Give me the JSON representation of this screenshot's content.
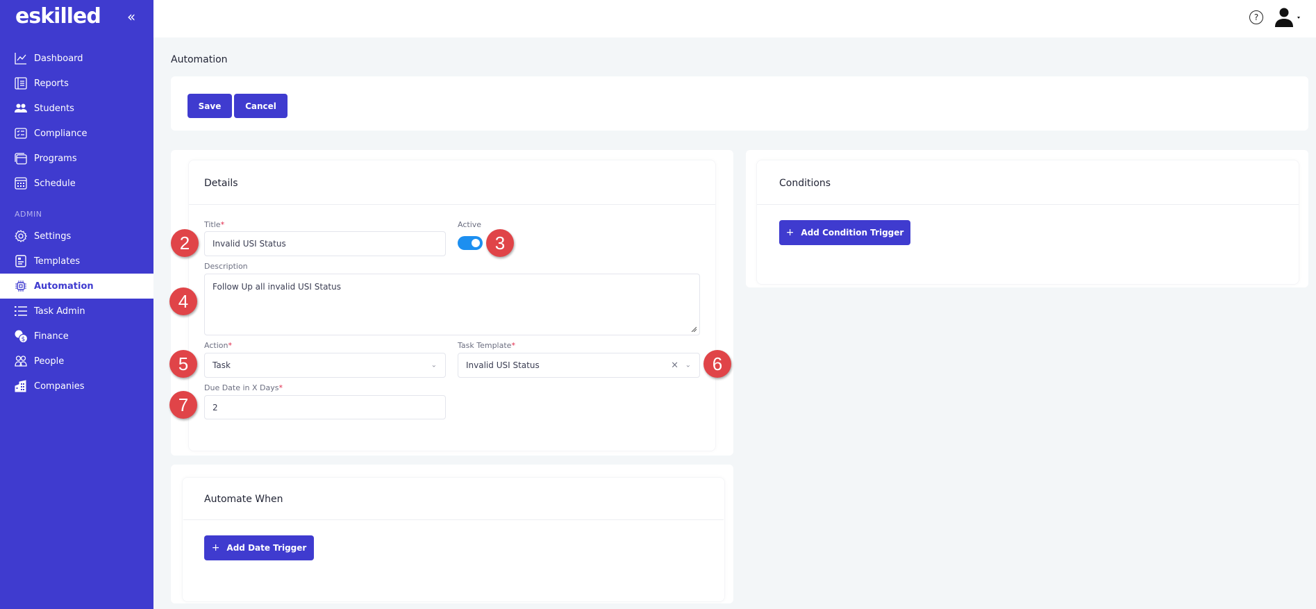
{
  "app": {
    "logo": "eskilled",
    "collapse_icon": "chevrons-left-icon"
  },
  "sidebar": {
    "items": [
      {
        "label": "Dashboard",
        "icon": "chart-line-icon"
      },
      {
        "label": "Reports",
        "icon": "report-icon"
      },
      {
        "label": "Students",
        "icon": "users-icon"
      },
      {
        "label": "Compliance",
        "icon": "checklist-icon"
      },
      {
        "label": "Programs",
        "icon": "window-stack-icon"
      },
      {
        "label": "Schedule",
        "icon": "calendar-icon"
      }
    ],
    "section_label": "ADMIN",
    "admin_items": [
      {
        "label": "Settings",
        "icon": "gear-icon"
      },
      {
        "label": "Templates",
        "icon": "template-icon"
      },
      {
        "label": "Automation",
        "icon": "chip-icon",
        "active": true
      },
      {
        "label": "Task Admin",
        "icon": "list-icon"
      },
      {
        "label": "Finance",
        "icon": "coins-icon"
      },
      {
        "label": "People",
        "icon": "people-icon"
      },
      {
        "label": "Companies",
        "icon": "building-icon"
      }
    ]
  },
  "topbar": {
    "help_icon": "help-circle-icon",
    "help_glyph": "?",
    "user_icon": "user-avatar-icon"
  },
  "page": {
    "title": "Automation",
    "toolbar": {
      "save_label": "Save",
      "cancel_label": "Cancel"
    }
  },
  "details": {
    "title": "Details",
    "title_label": "Title",
    "title_value": "Invalid USI Status",
    "active_label": "Active",
    "active_value": true,
    "description_label": "Description",
    "description_value": "Follow Up all invalid USI Status",
    "action_label": "Action",
    "action_value": "Task",
    "task_template_label": "Task Template",
    "task_template_value": "Invalid USI Status",
    "due_date_label": "Due Date in X Days",
    "due_date_value": "2",
    "required_mark": "*"
  },
  "automate_when": {
    "title": "Automate When",
    "add_button": "Add Date Trigger",
    "plus": "+"
  },
  "conditions": {
    "title": "Conditions",
    "add_button": "Add Condition Trigger",
    "plus": "+"
  },
  "annotations": [
    "2",
    "3",
    "4",
    "5",
    "6",
    "7"
  ],
  "colors": {
    "brand": "#3f3bcf",
    "toggle_on": "#1d8ff0",
    "required": "#e0294a",
    "annotation": "#e04448"
  }
}
